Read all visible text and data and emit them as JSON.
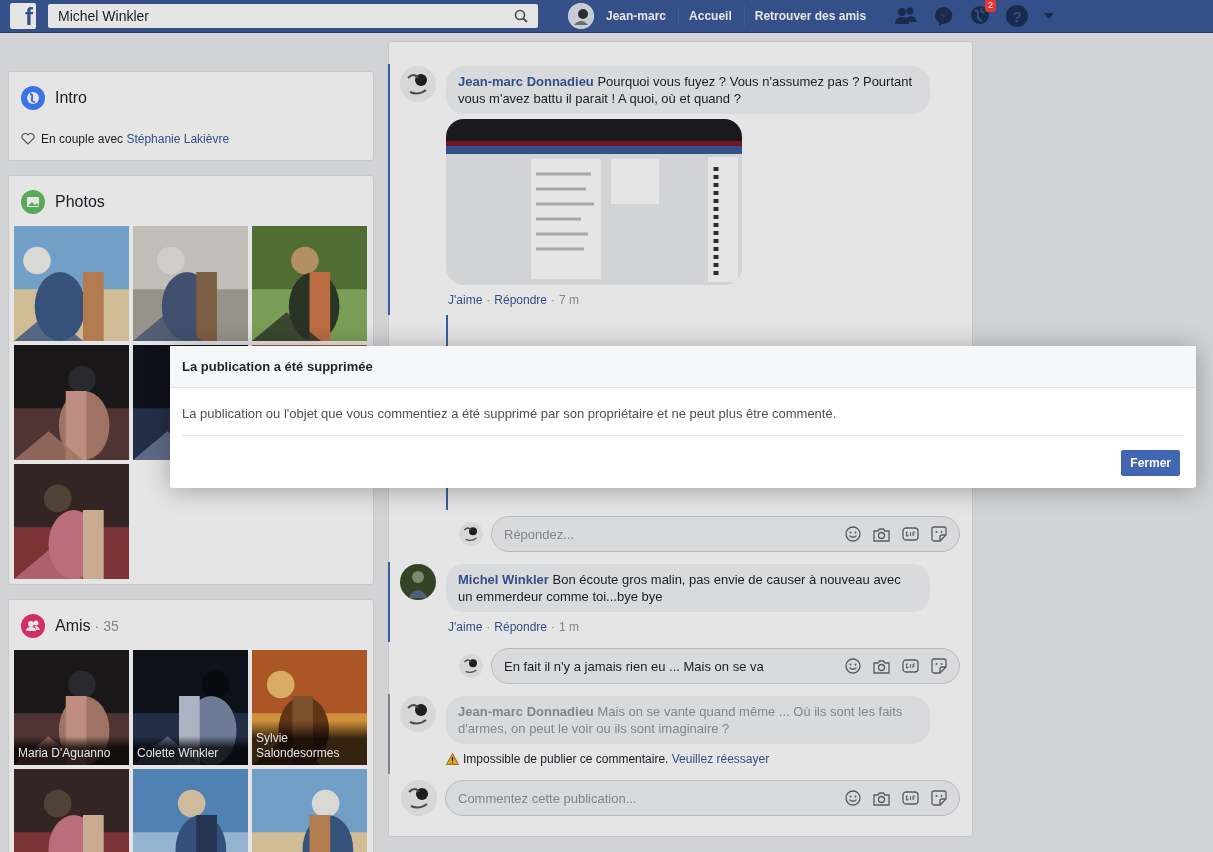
{
  "top_bar": {
    "logo": "f",
    "search": {
      "value": "Michel Winkler"
    },
    "profile": "Jean-marc",
    "nav": [
      "Accueil",
      "Retrouver des amis"
    ],
    "notification_count": "2",
    "help": "?"
  },
  "intro": {
    "title": "Intro",
    "relationship": "En couple avec",
    "partner": "Stéphanie Lakièvre"
  },
  "photos": {
    "title": "Photos",
    "items": [
      {
        "kind": "picture"
      },
      {
        "kind": "picture"
      },
      {
        "kind": "picture"
      },
      {
        "kind": "picture"
      },
      {
        "kind": "picture"
      },
      {
        "kind": "picture"
      },
      {
        "kind": "picture"
      }
    ]
  },
  "friends": {
    "title": "Amis",
    "separator": "·",
    "count": "35",
    "items": [
      {
        "kind": "picture",
        "name": "Maria D'Aguanno"
      },
      {
        "kind": "picture",
        "name": "Colette Winkler"
      },
      {
        "kind": "picture",
        "name": "Sylvie Salondesormes"
      },
      {
        "kind": "picture"
      },
      {
        "kind": "picture"
      },
      {
        "kind": "picture"
      }
    ]
  },
  "feed": [
    {
      "kind": "comment",
      "author": "Jean-marc Donnadieu",
      "text": "Pourquoi vous fuyez ? Vous n'assumez pas ? Pourtant vous m'avez battu il parait ! A quoi, où et quand ?",
      "attachment": {
        "kind": "picture"
      },
      "actions": [
        "J'aime",
        "Répondre"
      ],
      "separator": "·",
      "time": "7 m",
      "failed": false,
      "hidden_replies": true
    },
    {
      "kind": "field",
      "placeholder": "Répondez...",
      "nested": true
    },
    {
      "kind": "comment",
      "author": "Michel Winkler",
      "text": "Bon écoute gros malin, pas envie de causer à nouveau avec un emmerdeur comme toi...bye bye",
      "actions": [
        "J'aime",
        "Répondre"
      ],
      "separator": "·",
      "time": "1 m",
      "failed": false
    },
    {
      "kind": "field",
      "value": "En fait il n'y a jamais rien eu ... Mais on se va",
      "nested": true
    },
    {
      "kind": "comment",
      "author": "Jean-marc Donnadieu",
      "text": "Mais on se vante quand même ... Où ils sont les faits d'armes, on peut le voir ou ils sont imaginaire ?",
      "failed": true,
      "error": "Impossible de publier ce commentaire.",
      "retry": "Veuillez réessayer"
    },
    {
      "kind": "field",
      "placeholder": "Commentez cette publication...",
      "nested": false
    }
  ],
  "dialog": {
    "title": "La publication a été supprimée",
    "message": "La publication ou l'objet que vous commentiez a été supprimé par son propriétaire et ne peut plus être commenté.",
    "button": "Fermer"
  }
}
